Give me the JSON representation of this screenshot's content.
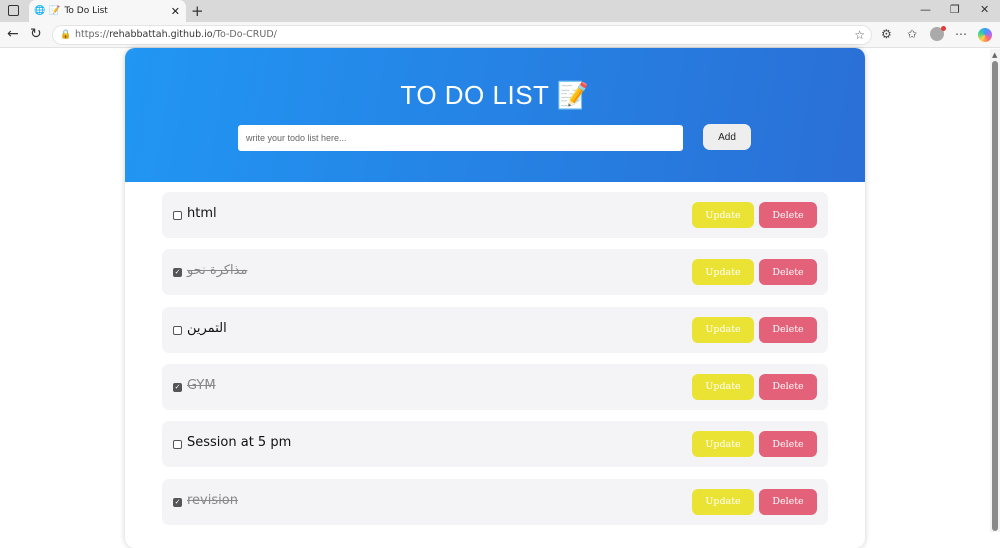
{
  "browser": {
    "tab_title": "To Do List",
    "url_prefix": "https://",
    "url_host": "rehabbattah.github.io",
    "url_path": "/To-Do-CRUD/"
  },
  "app": {
    "title": "TO DO LIST",
    "title_emoji": "📝",
    "input_placeholder": "write your todo list here...",
    "add_label": "Add",
    "update_label": "Update",
    "delete_label": "Delete",
    "todos": [
      {
        "text": "html",
        "done": false
      },
      {
        "text": "مذاكرة نحو",
        "done": true
      },
      {
        "text": "التمرين",
        "done": false
      },
      {
        "text": "GYM",
        "done": true
      },
      {
        "text": "Session at 5 pm",
        "done": false
      },
      {
        "text": "revision",
        "done": true
      }
    ]
  },
  "colors": {
    "update": "#ebe334",
    "delete": "#e4617a",
    "header_start": "#2196f3",
    "header_end": "#2a6fd6"
  }
}
